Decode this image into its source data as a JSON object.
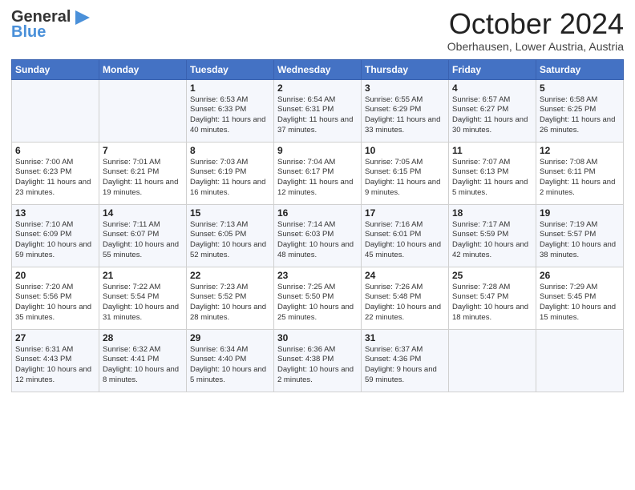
{
  "header": {
    "logo_line1": "General",
    "logo_line2": "Blue",
    "month_title": "October 2024",
    "location": "Oberhausen, Lower Austria, Austria"
  },
  "days_of_week": [
    "Sunday",
    "Monday",
    "Tuesday",
    "Wednesday",
    "Thursday",
    "Friday",
    "Saturday"
  ],
  "weeks": [
    [
      {
        "day": "",
        "info": ""
      },
      {
        "day": "",
        "info": ""
      },
      {
        "day": "1",
        "info": "Sunrise: 6:53 AM\nSunset: 6:33 PM\nDaylight: 11 hours and 40 minutes."
      },
      {
        "day": "2",
        "info": "Sunrise: 6:54 AM\nSunset: 6:31 PM\nDaylight: 11 hours and 37 minutes."
      },
      {
        "day": "3",
        "info": "Sunrise: 6:55 AM\nSunset: 6:29 PM\nDaylight: 11 hours and 33 minutes."
      },
      {
        "day": "4",
        "info": "Sunrise: 6:57 AM\nSunset: 6:27 PM\nDaylight: 11 hours and 30 minutes."
      },
      {
        "day": "5",
        "info": "Sunrise: 6:58 AM\nSunset: 6:25 PM\nDaylight: 11 hours and 26 minutes."
      }
    ],
    [
      {
        "day": "6",
        "info": "Sunrise: 7:00 AM\nSunset: 6:23 PM\nDaylight: 11 hours and 23 minutes."
      },
      {
        "day": "7",
        "info": "Sunrise: 7:01 AM\nSunset: 6:21 PM\nDaylight: 11 hours and 19 minutes."
      },
      {
        "day": "8",
        "info": "Sunrise: 7:03 AM\nSunset: 6:19 PM\nDaylight: 11 hours and 16 minutes."
      },
      {
        "day": "9",
        "info": "Sunrise: 7:04 AM\nSunset: 6:17 PM\nDaylight: 11 hours and 12 minutes."
      },
      {
        "day": "10",
        "info": "Sunrise: 7:05 AM\nSunset: 6:15 PM\nDaylight: 11 hours and 9 minutes."
      },
      {
        "day": "11",
        "info": "Sunrise: 7:07 AM\nSunset: 6:13 PM\nDaylight: 11 hours and 5 minutes."
      },
      {
        "day": "12",
        "info": "Sunrise: 7:08 AM\nSunset: 6:11 PM\nDaylight: 11 hours and 2 minutes."
      }
    ],
    [
      {
        "day": "13",
        "info": "Sunrise: 7:10 AM\nSunset: 6:09 PM\nDaylight: 10 hours and 59 minutes."
      },
      {
        "day": "14",
        "info": "Sunrise: 7:11 AM\nSunset: 6:07 PM\nDaylight: 10 hours and 55 minutes."
      },
      {
        "day": "15",
        "info": "Sunrise: 7:13 AM\nSunset: 6:05 PM\nDaylight: 10 hours and 52 minutes."
      },
      {
        "day": "16",
        "info": "Sunrise: 7:14 AM\nSunset: 6:03 PM\nDaylight: 10 hours and 48 minutes."
      },
      {
        "day": "17",
        "info": "Sunrise: 7:16 AM\nSunset: 6:01 PM\nDaylight: 10 hours and 45 minutes."
      },
      {
        "day": "18",
        "info": "Sunrise: 7:17 AM\nSunset: 5:59 PM\nDaylight: 10 hours and 42 minutes."
      },
      {
        "day": "19",
        "info": "Sunrise: 7:19 AM\nSunset: 5:57 PM\nDaylight: 10 hours and 38 minutes."
      }
    ],
    [
      {
        "day": "20",
        "info": "Sunrise: 7:20 AM\nSunset: 5:56 PM\nDaylight: 10 hours and 35 minutes."
      },
      {
        "day": "21",
        "info": "Sunrise: 7:22 AM\nSunset: 5:54 PM\nDaylight: 10 hours and 31 minutes."
      },
      {
        "day": "22",
        "info": "Sunrise: 7:23 AM\nSunset: 5:52 PM\nDaylight: 10 hours and 28 minutes."
      },
      {
        "day": "23",
        "info": "Sunrise: 7:25 AM\nSunset: 5:50 PM\nDaylight: 10 hours and 25 minutes."
      },
      {
        "day": "24",
        "info": "Sunrise: 7:26 AM\nSunset: 5:48 PM\nDaylight: 10 hours and 22 minutes."
      },
      {
        "day": "25",
        "info": "Sunrise: 7:28 AM\nSunset: 5:47 PM\nDaylight: 10 hours and 18 minutes."
      },
      {
        "day": "26",
        "info": "Sunrise: 7:29 AM\nSunset: 5:45 PM\nDaylight: 10 hours and 15 minutes."
      }
    ],
    [
      {
        "day": "27",
        "info": "Sunrise: 6:31 AM\nSunset: 4:43 PM\nDaylight: 10 hours and 12 minutes."
      },
      {
        "day": "28",
        "info": "Sunrise: 6:32 AM\nSunset: 4:41 PM\nDaylight: 10 hours and 8 minutes."
      },
      {
        "day": "29",
        "info": "Sunrise: 6:34 AM\nSunset: 4:40 PM\nDaylight: 10 hours and 5 minutes."
      },
      {
        "day": "30",
        "info": "Sunrise: 6:36 AM\nSunset: 4:38 PM\nDaylight: 10 hours and 2 minutes."
      },
      {
        "day": "31",
        "info": "Sunrise: 6:37 AM\nSunset: 4:36 PM\nDaylight: 9 hours and 59 minutes."
      },
      {
        "day": "",
        "info": ""
      },
      {
        "day": "",
        "info": ""
      }
    ]
  ]
}
